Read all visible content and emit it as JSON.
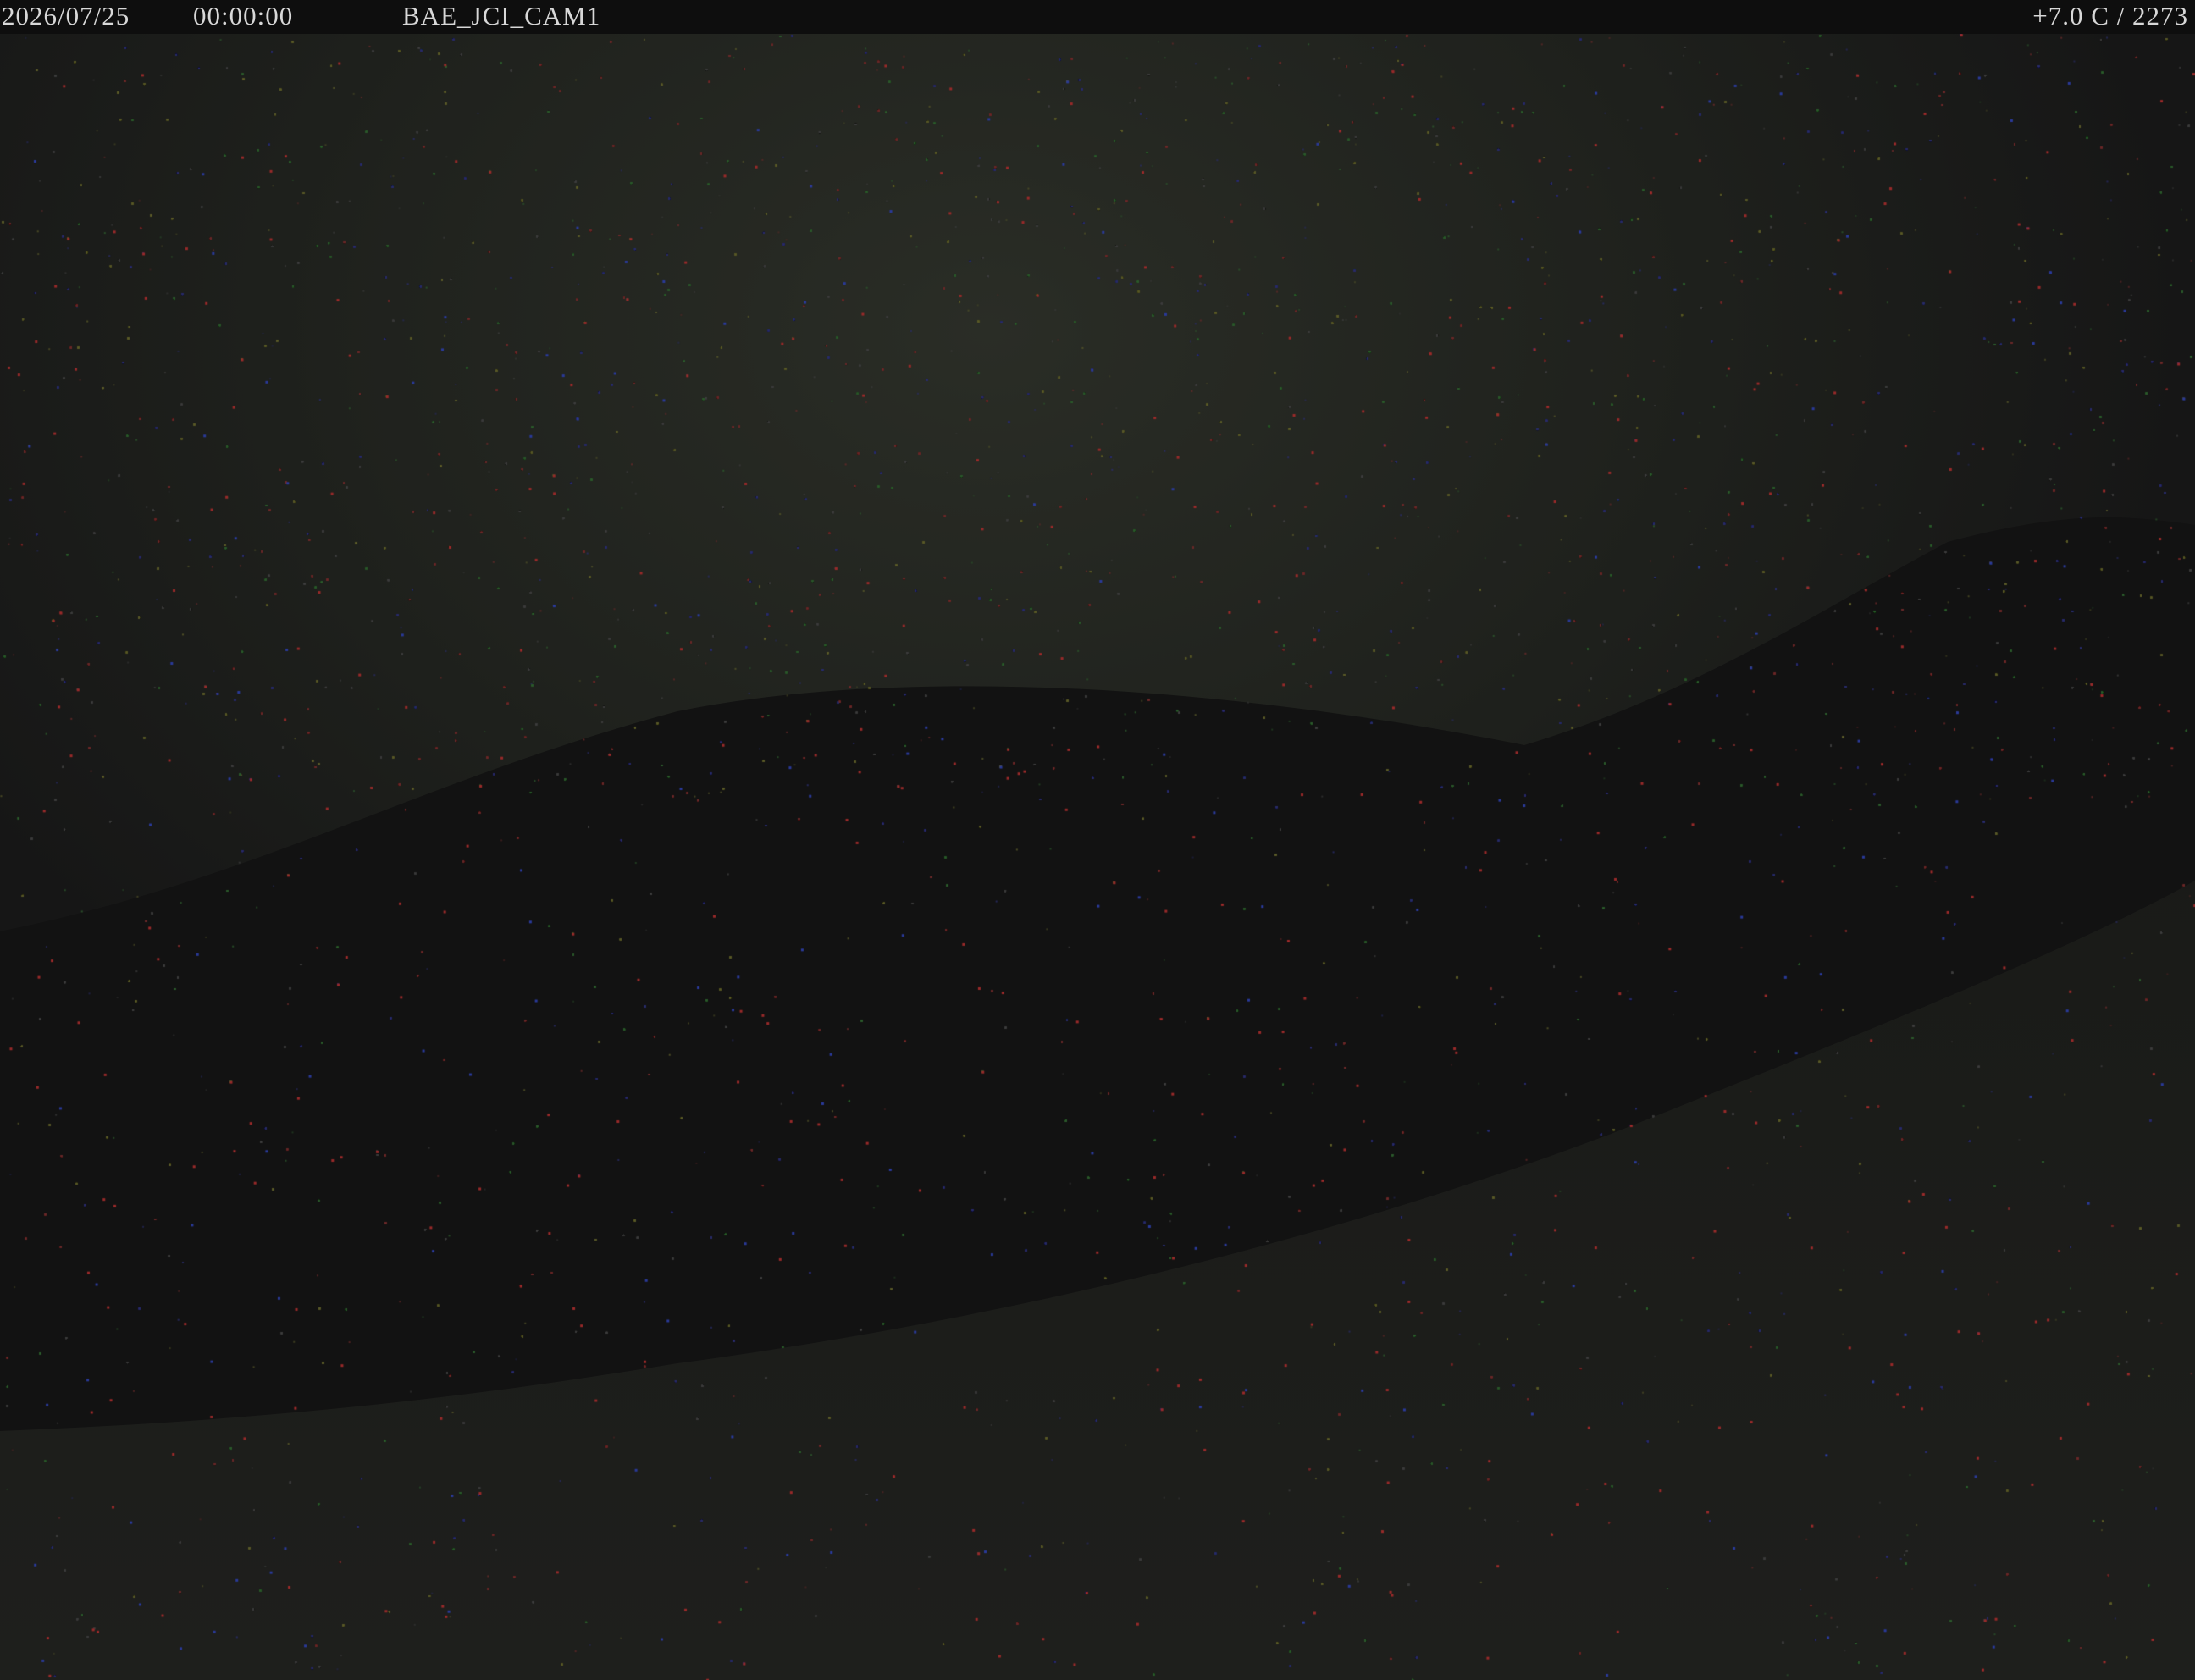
{
  "overlay": {
    "date": "2026/07/25",
    "time": "00:00:00",
    "camera_id": "BAE_JCI_CAM1",
    "temperature": "+7.0 C / 2273"
  },
  "colors": {
    "background": "#141414",
    "overlay_bar": "#0e0e0e",
    "overlay_text": "#d8d8d8",
    "sky_glow": "#2a2d26",
    "ridge_dark": "#111111"
  }
}
